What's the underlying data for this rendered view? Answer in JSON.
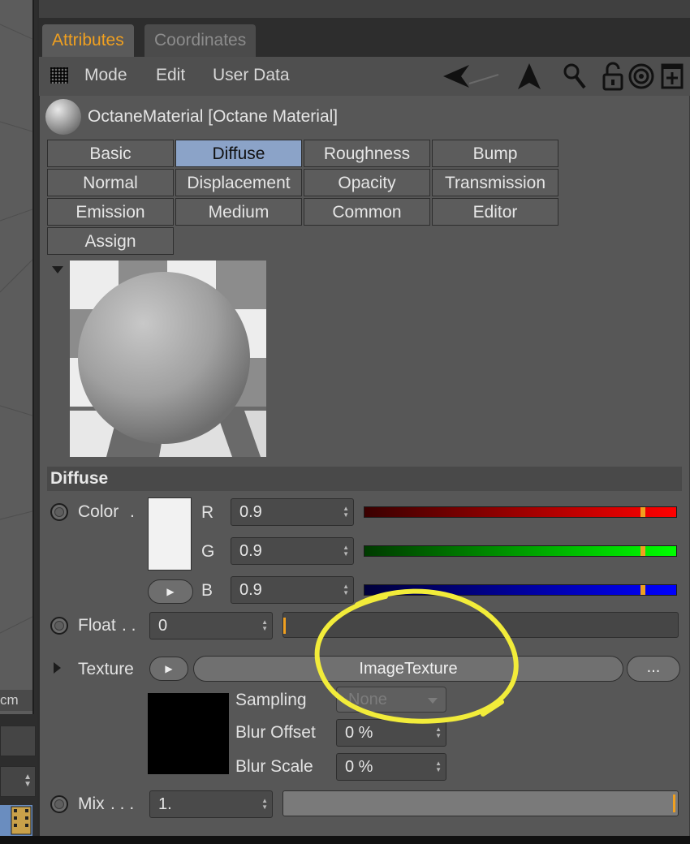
{
  "viewport": {
    "unit_label": "cm"
  },
  "tabs": {
    "attributes": "Attributes",
    "coordinates": "Coordinates"
  },
  "menu": {
    "mode": "Mode",
    "edit": "Edit",
    "user_data": "User Data"
  },
  "material": {
    "title": "OctaneMaterial [Octane Material]"
  },
  "subtabs": [
    "Basic",
    "Diffuse",
    "Roughness",
    "Bump",
    "Normal",
    "Displacement",
    "Opacity",
    "Transmission",
    "Emission",
    "Medium",
    "Common",
    "Editor",
    "Assign"
  ],
  "active_subtab": "Diffuse",
  "diffuse": {
    "heading": "Diffuse",
    "color_label": "Color",
    "color_dots": ".",
    "r_label": "R",
    "r_value": "0.9",
    "g_label": "G",
    "g_value": "0.9",
    "b_label": "B",
    "b_value": "0.9",
    "float_label": "Float",
    "float_dots": ". .",
    "float_value": "0",
    "texture_label": "Texture",
    "texture_name": "ImageTexture",
    "texture_more": "...",
    "sampling_label": "Sampling",
    "sampling_value": "None",
    "blur_offset_label": "Blur Offset",
    "blur_offset_value": "0 %",
    "blur_scale_label": "Blur Scale",
    "blur_scale_value": "0 %",
    "mix_label": "Mix",
    "mix_dots": ". . .",
    "mix_value": "1."
  },
  "colors": {
    "accent": "#f0a020",
    "active_tab": "#8ba3c8",
    "highlight_circle": "#f2ec3a"
  },
  "icons": [
    "grid-icon",
    "back-arrow-icon",
    "up-arrow-icon",
    "search-icon",
    "lock-icon",
    "target-icon",
    "new-panel-icon"
  ]
}
